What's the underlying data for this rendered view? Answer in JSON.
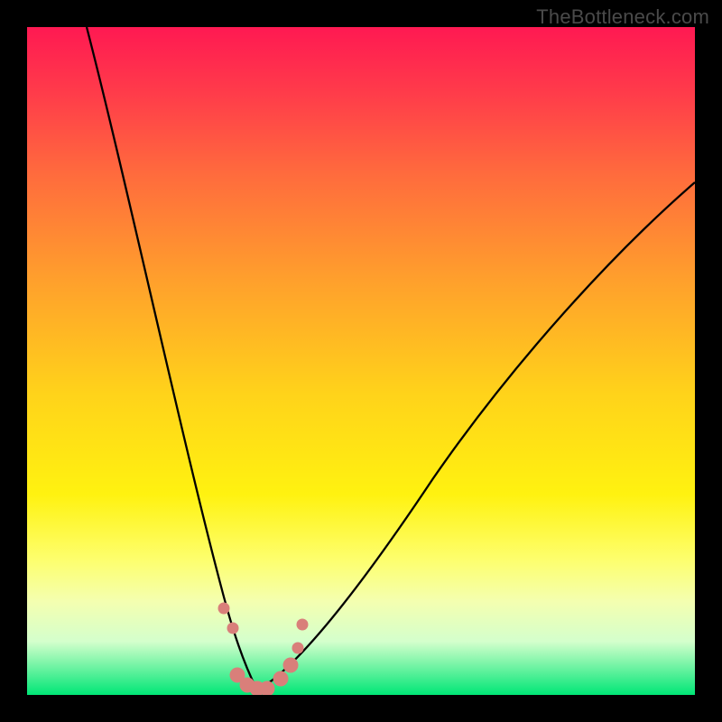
{
  "watermark": "TheBottleneck.com",
  "chart_data": {
    "type": "line",
    "title": "",
    "xlabel": "",
    "ylabel": "",
    "xlim": [
      0,
      100
    ],
    "ylim": [
      0,
      100
    ],
    "grid": false,
    "legend": false,
    "background_gradient": {
      "stops": [
        {
          "pos": 0.0,
          "color": "#ff1952"
        },
        {
          "pos": 0.1,
          "color": "#ff3c4a"
        },
        {
          "pos": 0.22,
          "color": "#ff6b3d"
        },
        {
          "pos": 0.38,
          "color": "#ffa02c"
        },
        {
          "pos": 0.55,
          "color": "#ffd31a"
        },
        {
          "pos": 0.7,
          "color": "#fff210"
        },
        {
          "pos": 0.8,
          "color": "#fdff70"
        },
        {
          "pos": 0.86,
          "color": "#f4ffb0"
        },
        {
          "pos": 0.92,
          "color": "#d4ffcc"
        },
        {
          "pos": 1.0,
          "color": "#00e676"
        }
      ]
    },
    "series": [
      {
        "name": "left-branch",
        "x": [
          9,
          12,
          15,
          18,
          21,
          24,
          26,
          28,
          30,
          31.5,
          33,
          34.5
        ],
        "y": [
          100,
          87,
          74,
          61,
          48,
          36,
          27,
          19,
          12,
          7,
          3,
          0.5
        ]
      },
      {
        "name": "right-branch",
        "x": [
          34.5,
          37,
          41,
          46,
          52,
          59,
          67,
          76,
          86,
          96,
          100
        ],
        "y": [
          0.5,
          2,
          6,
          12,
          20,
          29,
          39,
          50,
          62,
          73,
          77
        ]
      }
    ],
    "valley_points": {
      "name": "scatter-dots",
      "color": "#d97f7a",
      "points": [
        {
          "x": 29.5,
          "y": 13
        },
        {
          "x": 30.8,
          "y": 10
        },
        {
          "x": 31.5,
          "y": 3
        },
        {
          "x": 33.0,
          "y": 1.5
        },
        {
          "x": 34.5,
          "y": 1
        },
        {
          "x": 36.0,
          "y": 1
        },
        {
          "x": 38.0,
          "y": 2.5
        },
        {
          "x": 39.5,
          "y": 4.5
        },
        {
          "x": 40.5,
          "y": 7
        },
        {
          "x": 41.2,
          "y": 10.5
        }
      ]
    }
  }
}
